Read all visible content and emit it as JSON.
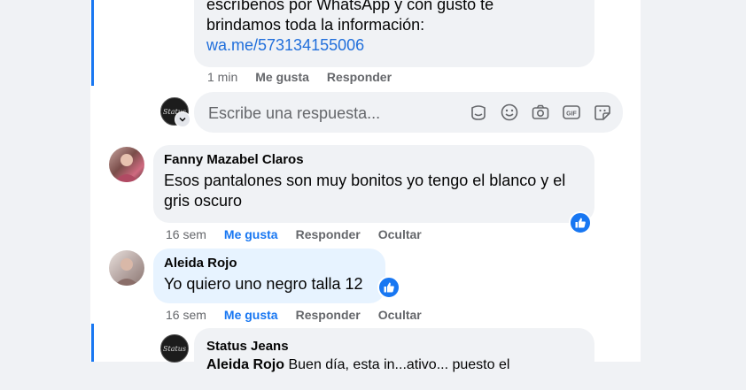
{
  "page_reply": {
    "lines": [
      "escríbenos por WhatsApp y con gusto te",
      "brindamos toda la información:"
    ],
    "link": "wa.me/573134155006",
    "time": "1 min",
    "like_label": "Me gusta",
    "reply_label": "Responder"
  },
  "reply_box": {
    "placeholder": "Escribe una respuesta...",
    "avatar_text": "Status",
    "icons": [
      "sticker-icon",
      "emoji-icon",
      "camera-icon",
      "gif-icon",
      "avatar-sticker-icon"
    ]
  },
  "comments": [
    {
      "author": "Fanny Mazabel Claros",
      "lines": [
        "Esos pantalones son muy bonitos yo tengo el blanco y el",
        "gris oscuro"
      ],
      "time": "16 sem",
      "like_label": "Me gusta",
      "reply_label": "Responder",
      "hide_label": "Ocultar"
    },
    {
      "author": "Aleida Rojo",
      "text": "Yo quiero uno negro talla 12",
      "time": "16 sem",
      "like_label": "Me gusta",
      "reply_label": "Responder",
      "hide_label": "Ocultar"
    }
  ],
  "nested_reply": {
    "author": "Status Jeans",
    "avatar_text": "Status",
    "mention": "Aleida Rojo",
    "text_start": "Buen día, esta in...ativo... puesto el"
  },
  "colors": {
    "accent": "#1877f2",
    "bubble": "#f0f2f5",
    "bubble_highlight": "#e7f3ff",
    "secondary_text": "#65676b"
  }
}
